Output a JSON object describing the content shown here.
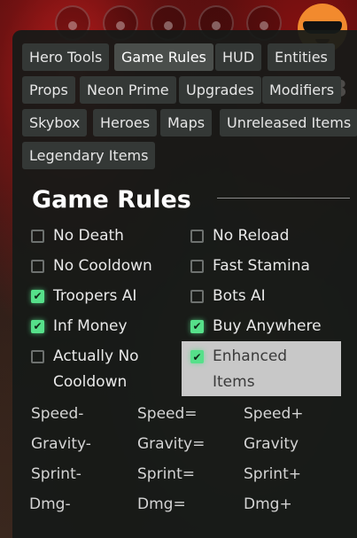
{
  "tabs": [
    {
      "label": "Hero Tools",
      "active": false
    },
    {
      "label": "Game Rules",
      "active": true
    },
    {
      "label": "HUD",
      "active": false
    },
    {
      "label": "Entities",
      "active": false
    },
    {
      "label": "Props",
      "active": false
    },
    {
      "label": "Neon Prime",
      "active": false
    },
    {
      "label": "Upgrades",
      "active": false
    },
    {
      "label": "Modifiers",
      "active": false
    },
    {
      "label": "Skybox",
      "active": false
    },
    {
      "label": "Heroes",
      "active": false
    },
    {
      "label": "Maps",
      "active": false
    },
    {
      "label": "Unreleased Items",
      "active": false
    },
    {
      "label": "Legendary Items",
      "active": false
    }
  ],
  "section": {
    "title": "Game Rules"
  },
  "rules": {
    "no_death": {
      "label": "No Death",
      "checked": false
    },
    "no_reload": {
      "label": "No Reload",
      "checked": false
    },
    "no_cooldown": {
      "label": "No Cooldown",
      "checked": false
    },
    "fast_stamina": {
      "label": "Fast Stamina",
      "checked": false
    },
    "troopers_ai": {
      "label": "Troopers AI",
      "checked": true
    },
    "bots_ai": {
      "label": "Bots AI",
      "checked": false
    },
    "inf_money": {
      "label": "Inf Money",
      "checked": true
    },
    "buy_anywhere": {
      "label": "Buy Anywhere",
      "checked": true
    },
    "actually_no_cooldown": {
      "line1": "Actually No",
      "line2": "Cooldown",
      "checked": false
    },
    "enhanced_items": {
      "line1": "Enhanced",
      "line2": "Items",
      "checked": true
    }
  },
  "controls": {
    "speed_minus": "Speed-",
    "speed_equal": "Speed=",
    "speed_plus": "Speed+",
    "gravity_minus": "Gravity-",
    "gravity_equal": "Gravity=",
    "gravity": "Gravity",
    "sprint_minus": "Sprint-",
    "sprint_equal": "Sprint=",
    "sprint_plus": "Sprint+",
    "dmg_minus": "Dmg-",
    "dmg_equal": "Dmg=",
    "dmg_plus": "Dmg+"
  },
  "colors": {
    "checkbox_on": "#56e08a",
    "panel": "#161a18",
    "tab": "#343836"
  },
  "icons": [
    "player-slot-icon",
    "avatar-sunglasses-icon",
    "checkmark-icon"
  ]
}
